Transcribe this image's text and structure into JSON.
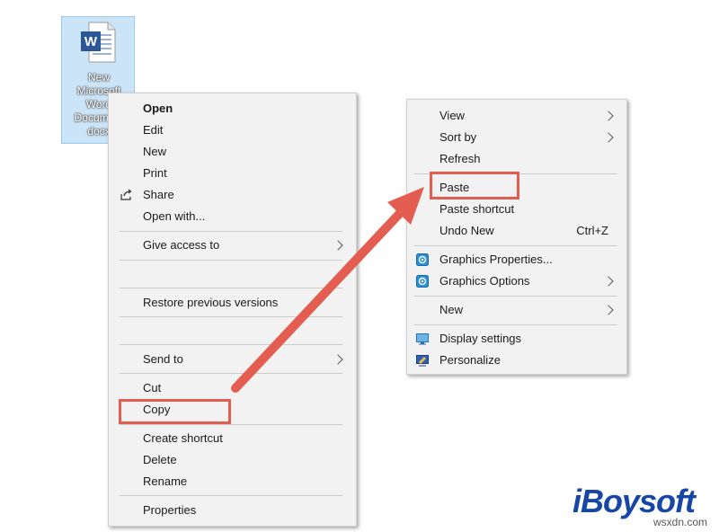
{
  "desktop_icon": {
    "label_lines": [
      "New",
      "Microsoft",
      "Word",
      "Document",
      "docx"
    ]
  },
  "context_menu_file": {
    "items": [
      {
        "label": "Open"
      },
      {
        "label": "Edit"
      },
      {
        "label": "New"
      },
      {
        "label": "Print"
      },
      {
        "label": "Share",
        "icon": "share-icon"
      },
      {
        "label": "Open with..."
      },
      {
        "label": "Give access to",
        "submenu": true
      },
      {
        "label": "Restore previous versions"
      },
      {
        "label": "Send to",
        "submenu": true
      },
      {
        "label": "Cut"
      },
      {
        "label": "Copy",
        "highlighted": true
      },
      {
        "label": "Create shortcut"
      },
      {
        "label": "Delete"
      },
      {
        "label": "Rename"
      },
      {
        "label": "Properties"
      }
    ]
  },
  "context_menu_desktop": {
    "items": [
      {
        "label": "View",
        "submenu": true
      },
      {
        "label": "Sort by",
        "submenu": true
      },
      {
        "label": "Refresh"
      },
      {
        "label": "Paste",
        "highlighted": true
      },
      {
        "label": "Paste shortcut"
      },
      {
        "label": "Undo New",
        "shortcut": "Ctrl+Z"
      },
      {
        "label": "Graphics Properties...",
        "icon": "graphics-icon"
      },
      {
        "label": "Graphics Options",
        "icon": "graphics-icon",
        "submenu": true
      },
      {
        "label": "New",
        "submenu": true
      },
      {
        "label": "Display settings",
        "icon": "display-icon"
      },
      {
        "label": "Personalize",
        "icon": "personalize-icon"
      }
    ]
  },
  "annotations": {
    "highlight_color": "#e35e51"
  },
  "brand": {
    "logo_text": "iBoysoft",
    "watermark": "wsxdn.com",
    "color": "#1747a6"
  }
}
